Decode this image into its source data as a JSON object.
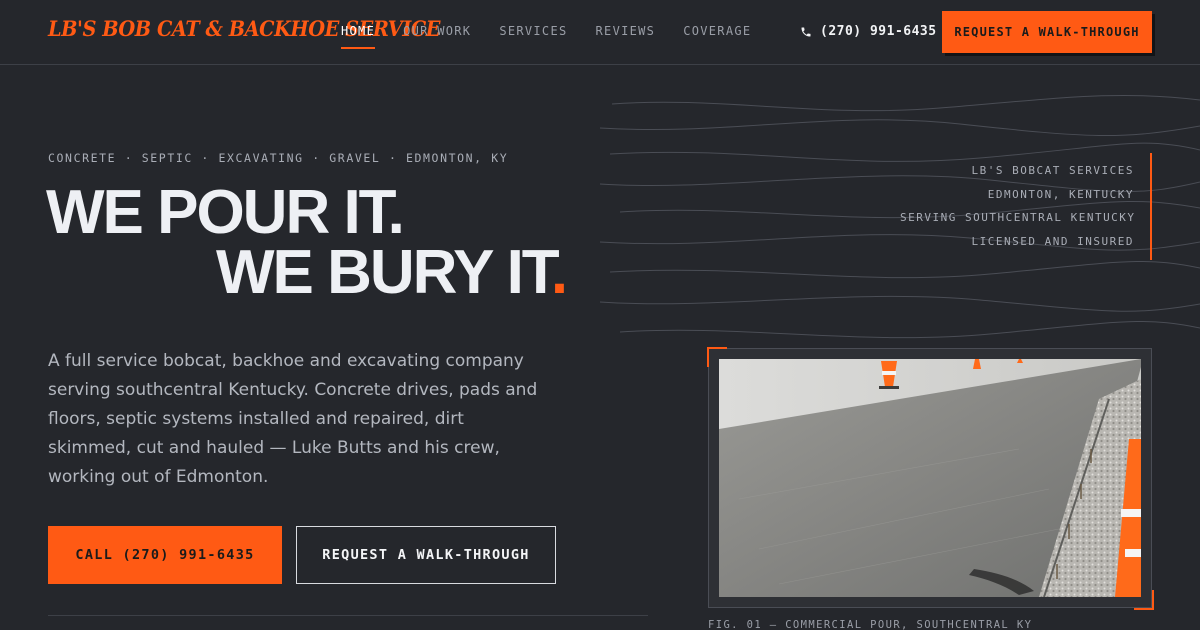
{
  "brand": {
    "logo_text": "LB'S BOB CAT & BACKHOE SERVICE"
  },
  "nav": {
    "items": [
      {
        "label": "HOME",
        "active": true
      },
      {
        "label": "OUR WORK",
        "active": false
      },
      {
        "label": "SERVICES",
        "active": false
      },
      {
        "label": "REVIEWS",
        "active": false
      },
      {
        "label": "COVERAGE",
        "active": false
      }
    ]
  },
  "header": {
    "phone": "(270) 991-6435",
    "cta_label": "REQUEST A WALK-THROUGH"
  },
  "hero": {
    "eyebrow": "CONCRETE · SEPTIC · EXCAVATING · GRAVEL · EDMONTON, KY",
    "headline_line1": "WE POUR IT.",
    "headline_line2": "WE BURY IT",
    "headline_dot": ".",
    "lede": "A full service bobcat, backhoe and excavating company serving southcentral Kentucky. Concrete drives, pads and floors, septic systems installed and repaired, dirt skimmed, cut and hauled — Luke Butts and his crew, working out of Edmonton.",
    "call_label": "CALL (270) 991-6435",
    "walk_label": "REQUEST A WALK-THROUGH"
  },
  "spec": {
    "lines": [
      "LB'S BOBCAT SERVICES",
      "EDMONTON, KENTUCKY",
      "SERVING SOUTHCENTRAL KENTUCKY",
      "LICENSED AND INSURED"
    ]
  },
  "photo": {
    "caption": "FIG. 01 — COMMERCIAL POUR, SOUTHCENTRAL KY"
  },
  "colors": {
    "accent": "#ff5a14",
    "background": "#25272c",
    "text": "#eceef2",
    "muted": "#a9adb6"
  },
  "icons": {
    "phone": "phone-icon"
  }
}
